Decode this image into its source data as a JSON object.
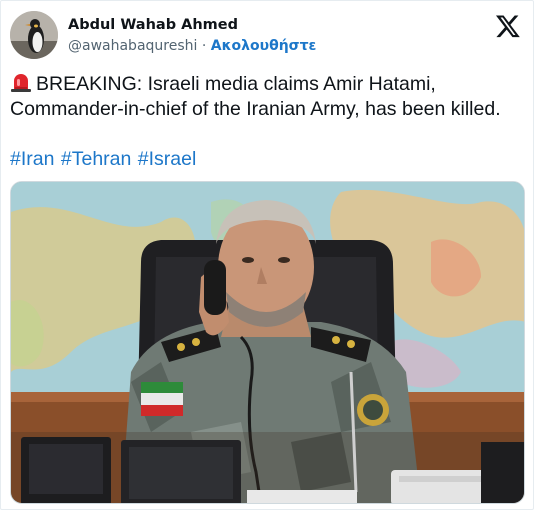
{
  "author": {
    "display_name": "Abdul Wahab Ahmed",
    "handle": "@awahabaqureshi",
    "separator": "·",
    "follow_label": "Ακολουθήστε"
  },
  "tweet": {
    "text": "BREAKING: Israeli media claims Amir Hatami, Commander-in-chief of the Iranian Army, has been killed.",
    "hashtags": [
      "#Iran",
      "#Tehran",
      "#Israel"
    ]
  },
  "icons": {
    "platform": "x-logo-icon",
    "alert": "rotating-light-siren-icon"
  },
  "colors": {
    "link": "#1d77c9",
    "text": "#0f1419",
    "muted": "#536471"
  }
}
